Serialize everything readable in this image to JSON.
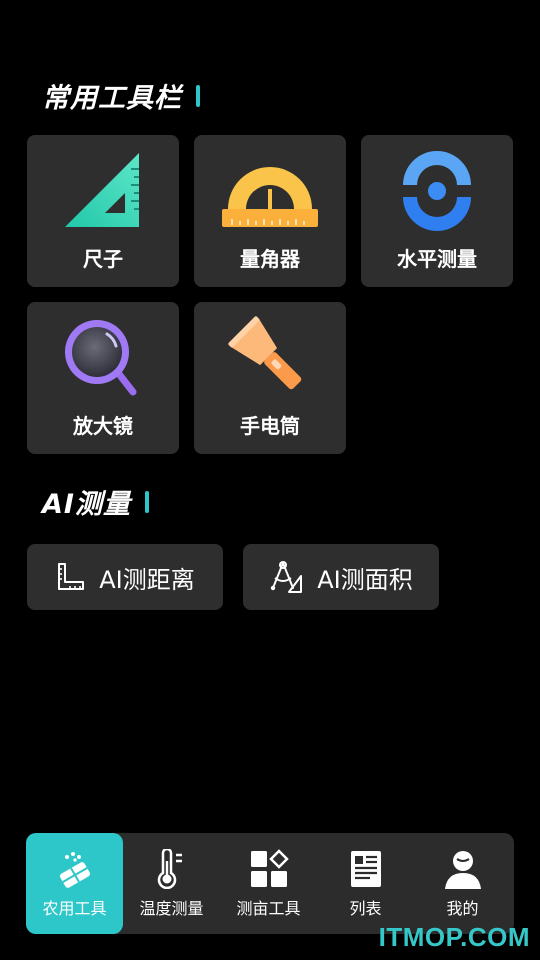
{
  "sections": {
    "common_title": "常用工具栏",
    "ai_title": "AI测量"
  },
  "tools": [
    {
      "label": "尺子",
      "icon": "triangle-ruler-icon"
    },
    {
      "label": "量角器",
      "icon": "protractor-icon"
    },
    {
      "label": "水平测量",
      "icon": "level-icon"
    },
    {
      "label": "放大镜",
      "icon": "magnifier-icon"
    },
    {
      "label": "手电筒",
      "icon": "flashlight-icon"
    }
  ],
  "ai_tools": [
    {
      "label": "AI测距离",
      "icon": "ruler-corner-icon"
    },
    {
      "label": "AI测面积",
      "icon": "compass-area-icon"
    }
  ],
  "nav": [
    {
      "label": "农用工具",
      "icon": "farm-tools-icon",
      "active": true
    },
    {
      "label": "温度测量",
      "icon": "thermometer-icon",
      "active": false
    },
    {
      "label": "测亩工具",
      "icon": "grid-tools-icon",
      "active": false
    },
    {
      "label": "列表",
      "icon": "list-doc-icon",
      "active": false
    },
    {
      "label": "我的",
      "icon": "user-icon",
      "active": false
    }
  ],
  "watermark": "ITMOP.COM",
  "colors": {
    "accent": "#2ec7c9",
    "card_bg": "#2e2e2e",
    "background": "#000000"
  }
}
